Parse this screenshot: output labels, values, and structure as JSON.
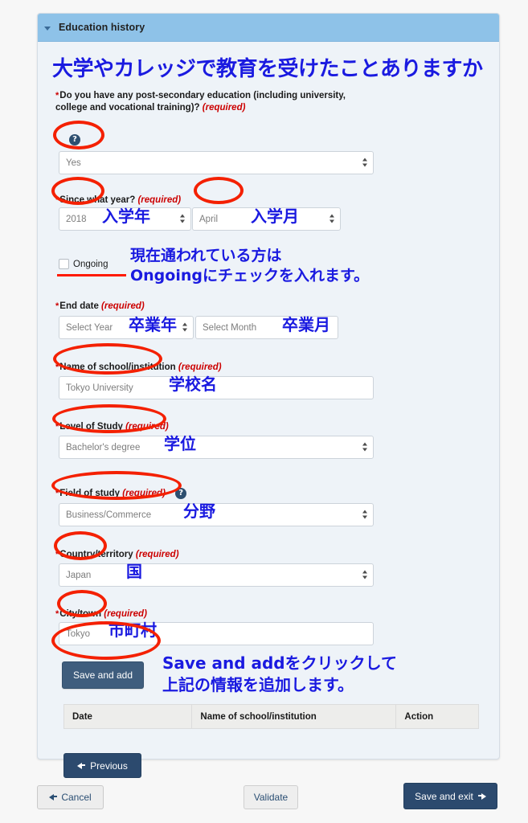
{
  "panel": {
    "title": "Education history",
    "collapse_icon": "chevron-down-icon"
  },
  "annotations": {
    "heading_jp": "大学やカレッジで教育を受けたことありますか",
    "entry_year_jp": "入学年",
    "entry_month_jp": "入学月",
    "ongoing_note_line1": "現在通われている方は",
    "ongoing_note_line2": "Ongoingにチェックを入れます。",
    "grad_year_jp": "卒業年",
    "grad_month_jp": "卒業月",
    "school_name_jp": "学校名",
    "level_jp": "学位",
    "field_jp": "分野",
    "country_jp": "国",
    "city_jp": "市町村",
    "save_add_note_line1": "Save and addをクリックして",
    "save_add_note_line2": "上記の情報を追加します。",
    "accent_color": "#1a1ae0",
    "highlight_color": "#f42000"
  },
  "fields": {
    "post_secondary": {
      "label": "Do you have any post-secondary education (including university, college and vocational training)?",
      "required_text": "(required)",
      "help_icon": "question-mark-icon",
      "value": "Yes"
    },
    "since_year": {
      "label": "Since what year?",
      "required_text": "(required)",
      "year_value": "2018",
      "month_value": "April"
    },
    "ongoing": {
      "label": "Ongoing",
      "checked": false
    },
    "end_date": {
      "label": "End date",
      "required_text": "(required)",
      "year_placeholder": "Select Year",
      "month_placeholder": "Select Month"
    },
    "school_name": {
      "label": "Name of school/institution",
      "required_text": "(required)",
      "value": "Tokyo University"
    },
    "level_of_study": {
      "label": "Level of Study",
      "required_text": "(required)",
      "value": "Bachelor's degree"
    },
    "field_of_study": {
      "label": "Field of study",
      "required_text": "(required)",
      "help_icon": "question-mark-icon",
      "value": "Business/Commerce"
    },
    "country": {
      "label": "Country/territory",
      "required_text": "(required)",
      "value": "Japan"
    },
    "city": {
      "label": "City/town",
      "required_text": "(required)",
      "value": "Tokyo"
    }
  },
  "buttons": {
    "save_and_add": "Save and add",
    "previous": "Previous",
    "cancel": "Cancel",
    "validate": "Validate",
    "save_and_exit": "Save and exit"
  },
  "table": {
    "columns": [
      "Date",
      "Name of school/institution",
      "Action"
    ],
    "rows": []
  }
}
